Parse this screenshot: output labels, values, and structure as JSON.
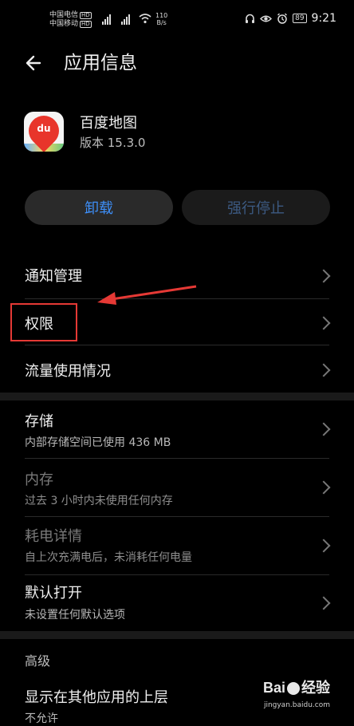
{
  "status_bar": {
    "carrier1": "中国电信",
    "carrier2": "中国移动",
    "hd_badge": "HD",
    "net_speed_value": "110",
    "net_speed_unit": "B/s",
    "battery": "89",
    "time": "9:21",
    "icons": [
      "headphones-icon",
      "eye-icon",
      "alarm-icon"
    ]
  },
  "header": {
    "title": "应用信息",
    "back_icon": "arrow-left-icon"
  },
  "app": {
    "name": "百度地图",
    "version": "版本 15.3.0",
    "icon_text": "du"
  },
  "buttons": {
    "uninstall": "卸载",
    "force_stop": "强行停止"
  },
  "settings": {
    "notifications": "通知管理",
    "permissions": "权限",
    "data_usage": "流量使用情况",
    "storage": {
      "label": "存储",
      "sub": "内部存储空间已使用 436 MB"
    },
    "memory": {
      "label": "内存",
      "sub": "过去 3 小时内未使用任何内存"
    },
    "battery": {
      "label": "耗电详情",
      "sub": "自上次充满电后，未消耗任何电量"
    },
    "default_open": {
      "label": "默认打开",
      "sub": "未设置任何默认选项"
    },
    "advanced_header": "高级",
    "display_over": {
      "label": "显示在其他应用的上层",
      "sub": "不允许"
    }
  },
  "watermark": {
    "brand_a": "Bai",
    "brand_b": "经验",
    "url": "jingyan.baidu.com"
  },
  "colors": {
    "accent": "#3d8ef7",
    "highlight": "#e53935",
    "background": "#000000"
  }
}
